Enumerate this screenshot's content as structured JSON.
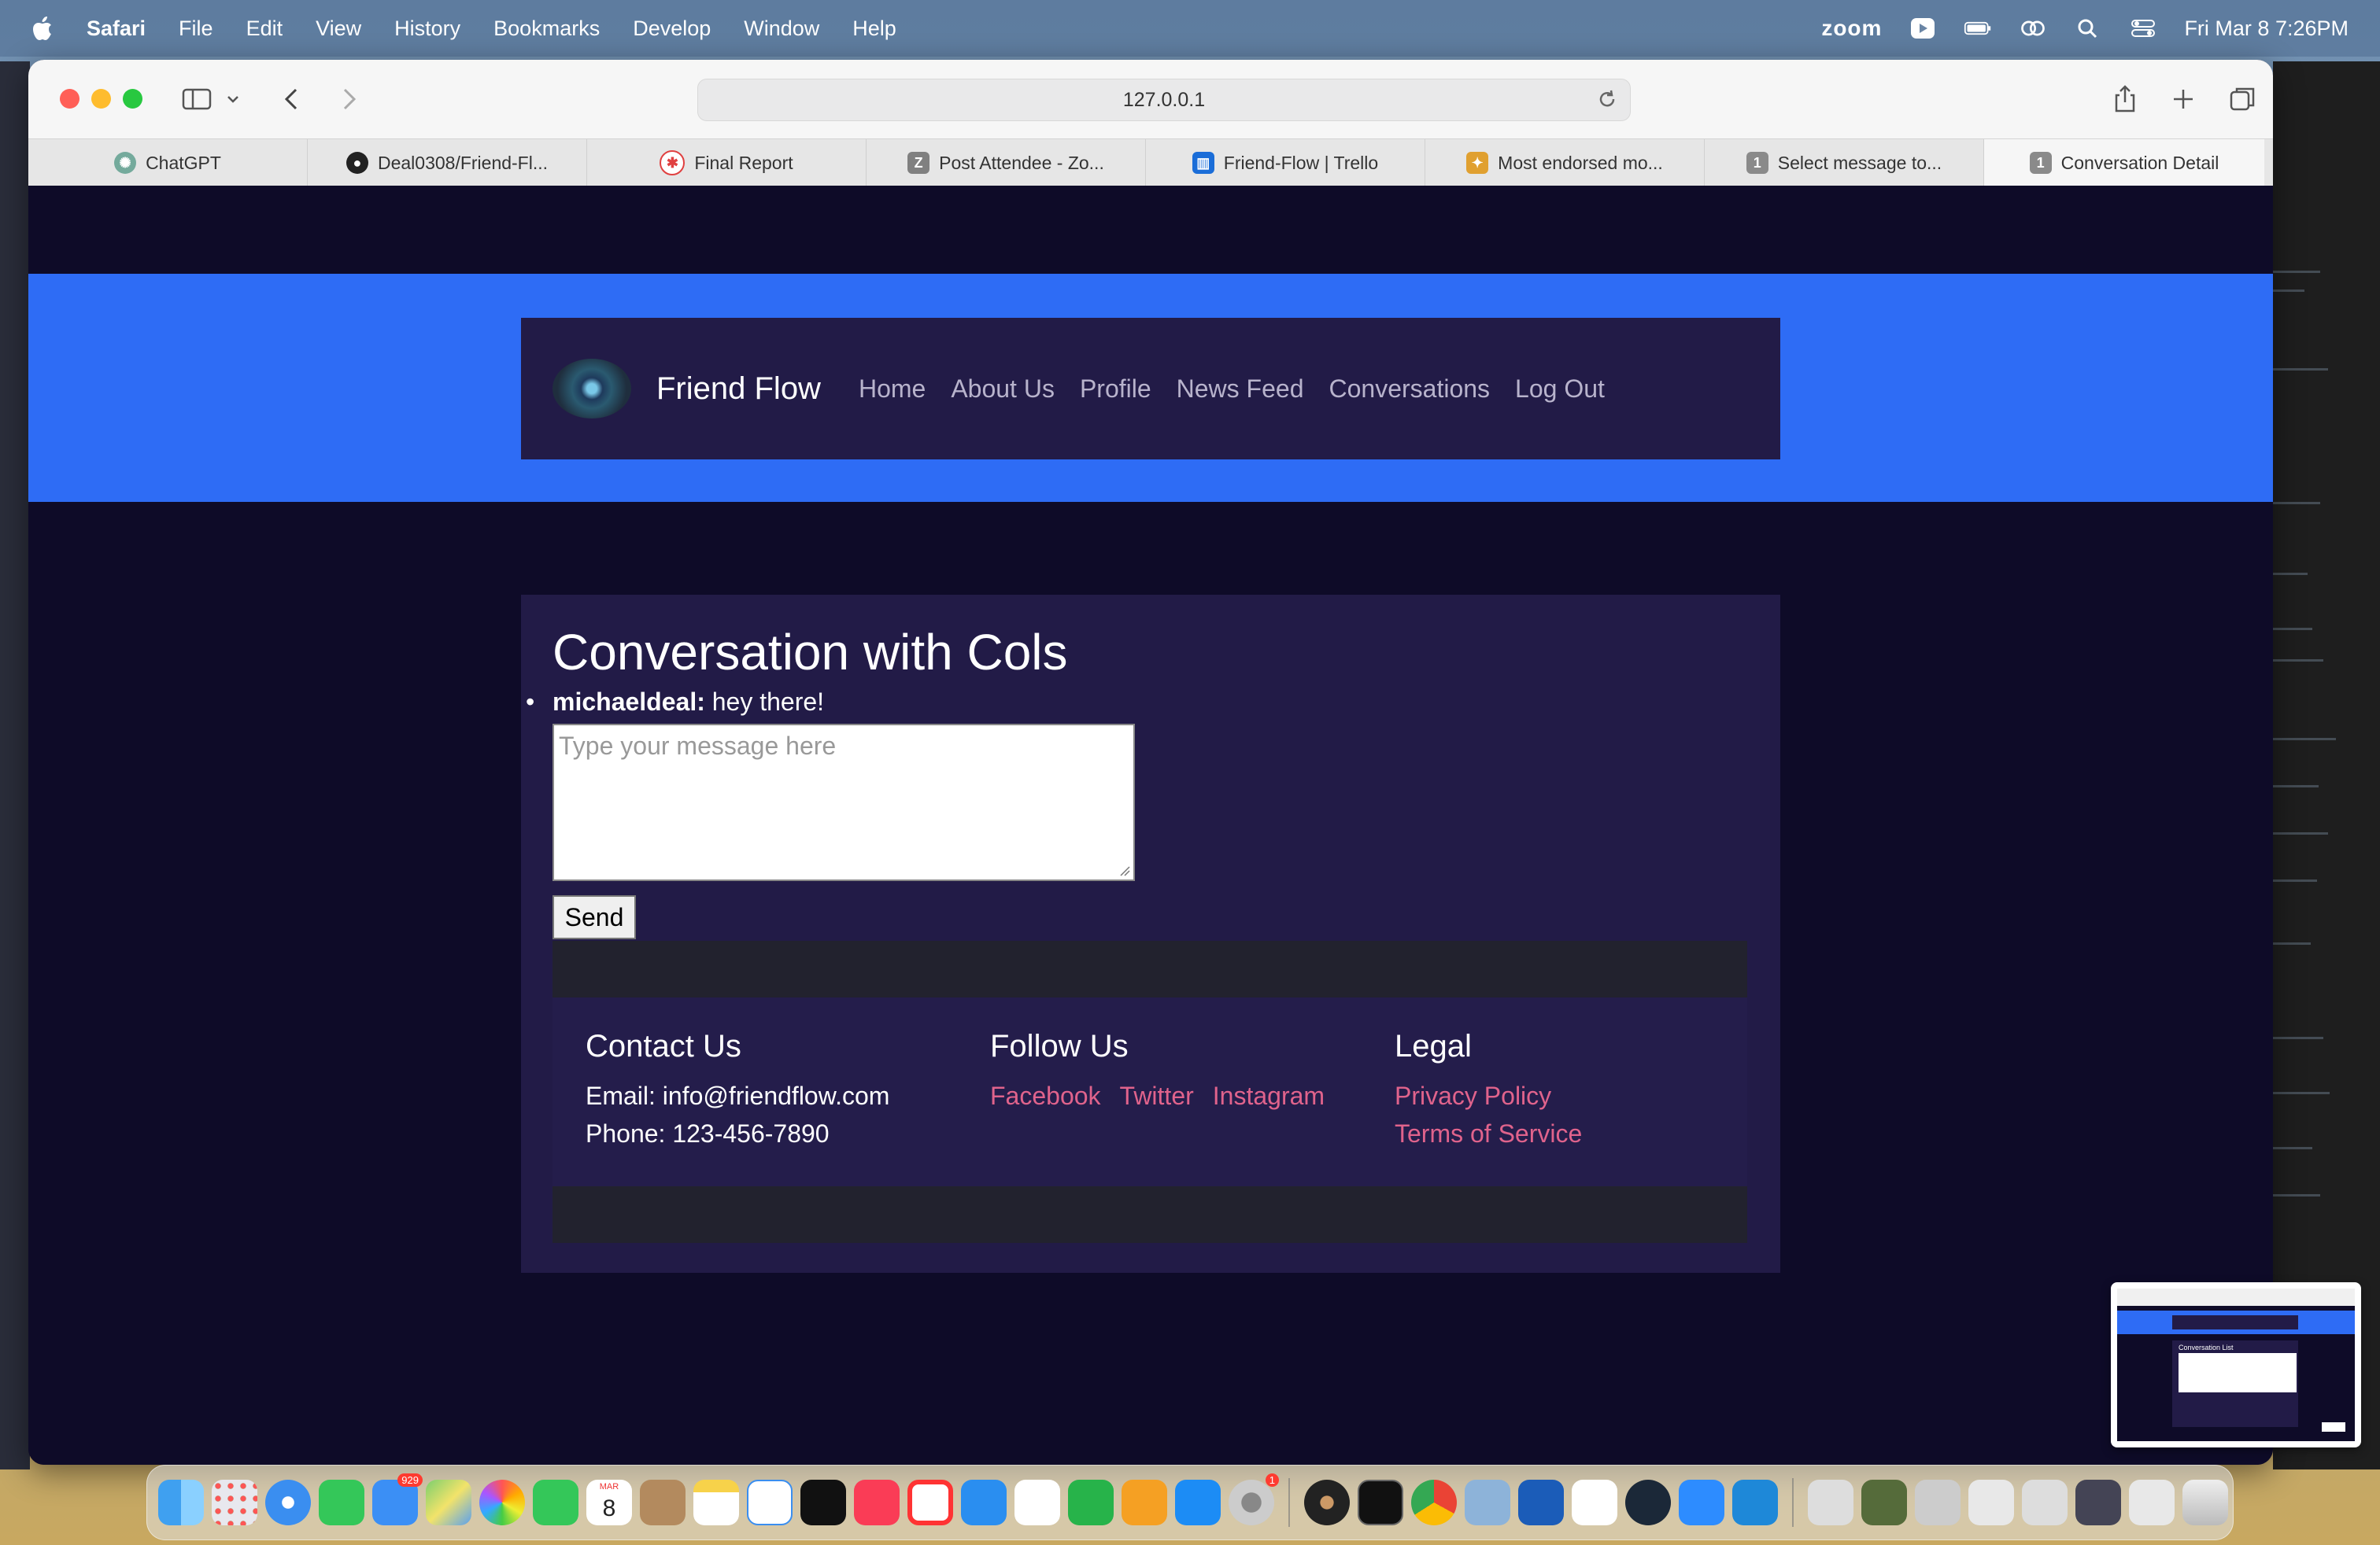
{
  "menubar": {
    "app": "Safari",
    "items": [
      "File",
      "Edit",
      "View",
      "History",
      "Bookmarks",
      "Develop",
      "Window",
      "Help"
    ],
    "zoom_label": "zoom",
    "datetime": "Fri Mar 8  7:26PM"
  },
  "browser": {
    "url": "127.0.0.1",
    "tabs": [
      {
        "title": "ChatGPT",
        "icon": "chatgpt-icon",
        "color": "#74aa9c"
      },
      {
        "title": "Deal0308/Friend-Fl...",
        "icon": "github-icon",
        "color": "#222222"
      },
      {
        "title": "Final Report",
        "icon": "report-icon",
        "color": "#e04040"
      },
      {
        "title": "Post Attendee - Zo...",
        "icon": "zoom-z-icon",
        "color": "#808080"
      },
      {
        "title": "Friend-Flow | Trello",
        "icon": "trello-icon",
        "color": "#1a6dd8"
      },
      {
        "title": "Most endorsed mo...",
        "icon": "endorsed-icon",
        "color": "#e0a030"
      },
      {
        "title": "Select message to...",
        "icon": "number-1-icon",
        "color": "#8a8a8a"
      },
      {
        "title": "Conversation Detail",
        "icon": "number-1-icon",
        "color": "#8a8a8a"
      }
    ]
  },
  "site": {
    "brand": "Friend Flow",
    "nav": [
      "Home",
      "About Us",
      "Profile",
      "News Feed",
      "Conversations",
      "Log Out"
    ]
  },
  "conversation": {
    "title": "Conversation with Cols",
    "messages": [
      {
        "author": "michaeldeal:",
        "text": " hey there!"
      }
    ],
    "input_placeholder": "Type your message here",
    "send_label": "Send"
  },
  "footer": {
    "contact": {
      "heading": "Contact Us",
      "email": "Email: info@friendflow.com",
      "phone": "Phone: 123-456-7890"
    },
    "follow": {
      "heading": "Follow Us",
      "links": [
        "Facebook",
        "Twitter",
        "Instagram"
      ]
    },
    "legal": {
      "heading": "Legal",
      "links": [
        "Privacy Policy",
        "Terms of Service"
      ]
    }
  },
  "thumbnail": {
    "title": "Conversation List"
  },
  "dock": {
    "mail_badge": "929",
    "calendar_month": "MAR",
    "calendar_day": "8",
    "settings_badge": "1"
  },
  "colors": {
    "page_bg": "#0e0b28",
    "hero_blue": "#2e6cf5",
    "card_bg": "#221b47",
    "link_pink": "#e0638c"
  }
}
